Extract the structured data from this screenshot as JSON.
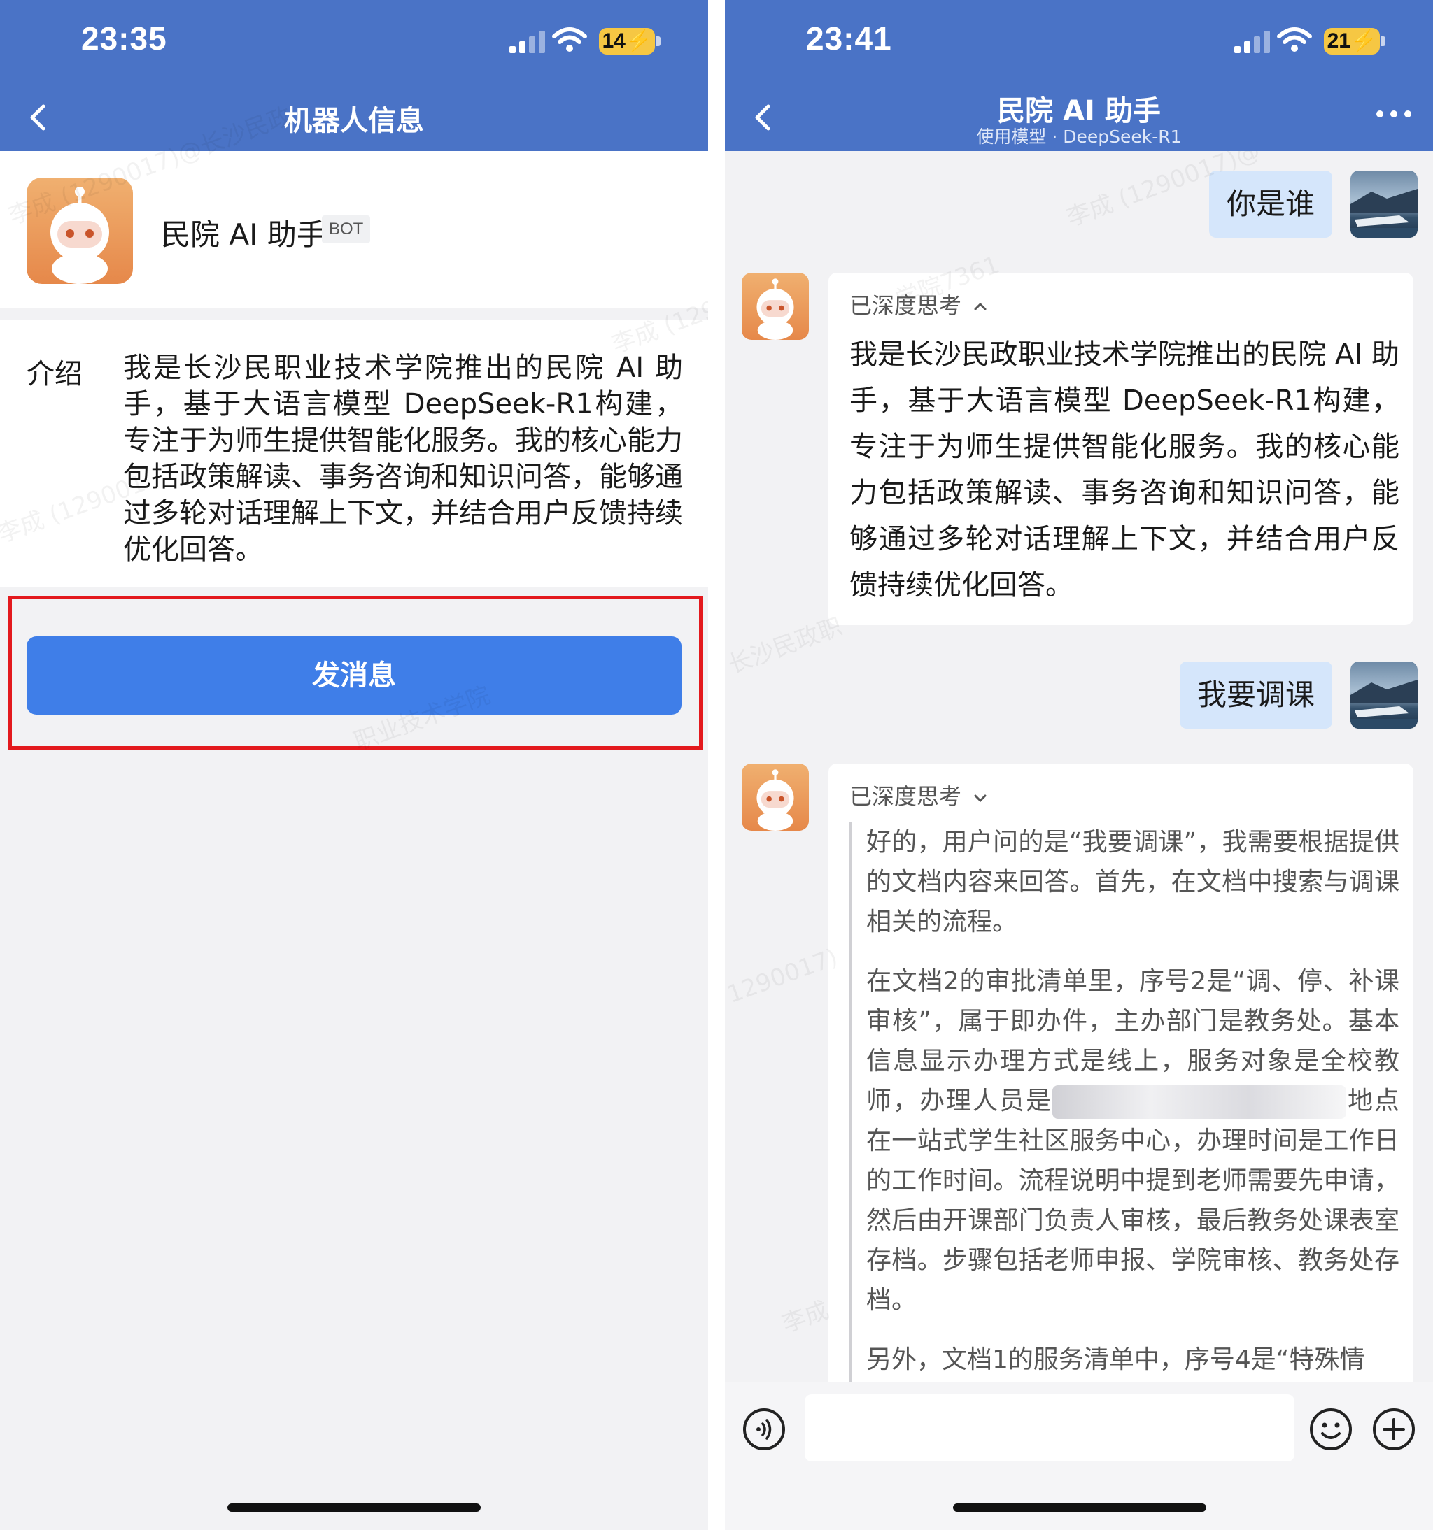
{
  "left": {
    "status": {
      "time": "23:35",
      "battery": "14"
    },
    "nav": {
      "title": "机器人信息"
    },
    "profile": {
      "name": "民院 AI 助手",
      "badge": "BOT"
    },
    "intro": {
      "label": "介绍",
      "text": "我是长沙民职业技术学院推出的民院 AI 助手，基于大语言模型 DeepSeek-R1构建，专注于为师生提供智能化服务。我的核心能力包括政策解读、事务咨询和知识问答，能够通过多轮对话理解上下文，并结合用户反馈持续优化回答。"
    },
    "send_button": "发消息"
  },
  "right": {
    "status": {
      "time": "23:41",
      "battery": "21"
    },
    "nav": {
      "title": "民院 AI 助手",
      "subtitle": "使用模型 · DeepSeek-R1"
    },
    "messages": {
      "q1": "你是谁",
      "a1_think": "已深度思考",
      "a1": "我是长沙民政职业技术学院推出的民院 AI 助手，基于大语言模型 DeepSeek-R1构建，专注于为师生提供智能化服务。我的核心能力包括政策解读、事务咨询和知识问答，能够通过多轮对话理解上下文，并结合用户反馈持续优化回答。",
      "q2": "我要调课",
      "a2_think": "已深度思考",
      "a2_p1": "好的，用户问的是“我要调课”，我需要根据提供的文档内容来回答。首先，在文档中搜索与调课相关的流程。",
      "a2_p2a": "在文档2的审批清单里，序号2是“调、停、补课审核”，属于即办件，主办部门是教务处。基本信息显示办理方式是线上，服务对象是全校教师，办理人员是",
      "a2_p2b": "地点在一站式学生社区服务中心，办理时间是工作日的工作时间。流程说明中提到老师需要先申请，然后由开课部门负责人审核，最后教务处课表室存档。步骤包括老师申报、学院审核、教务处存档。",
      "a2_p3": "另外，文档1的服务清单中，序号4是“特殊情"
    }
  },
  "watermarks": [
    "李成 (1290017)@长沙民政",
    "李成 (129",
    "学院7361",
    "李成 (129001",
    "李成 (1290017)@",
    "长沙民政职",
    "职业技术学院",
    "李成",
    "1290017)"
  ],
  "colors": {
    "header": "#4a73c6",
    "primary_button": "#3f7ee8",
    "highlight": "#e3191d",
    "user_bubble": "#d5e6fb"
  }
}
